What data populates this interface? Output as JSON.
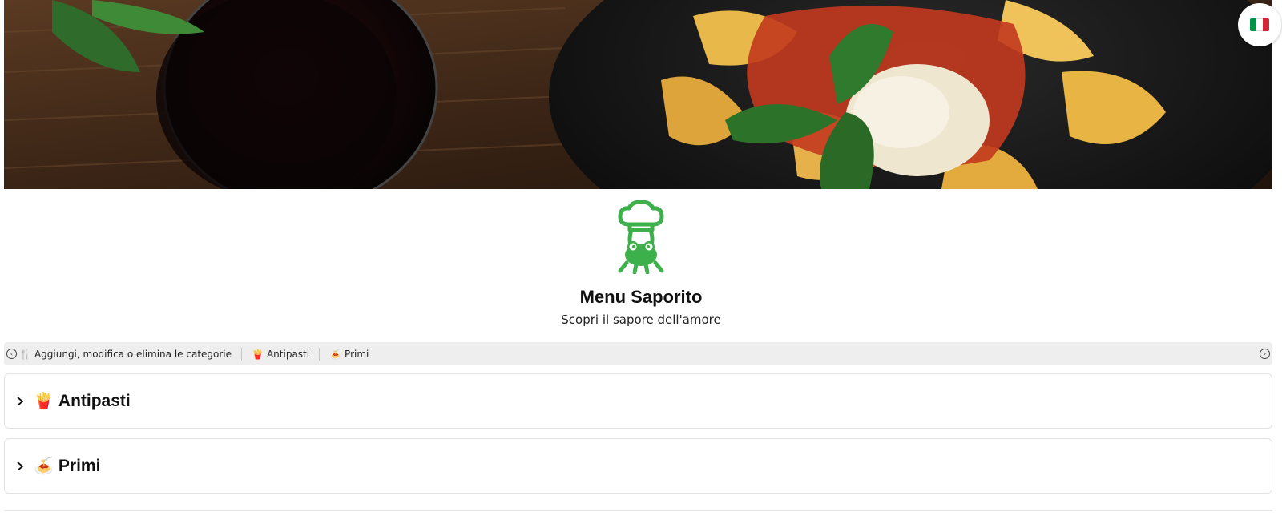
{
  "hero": {
    "image": "pasta-and-red-wine-photo"
  },
  "language": {
    "flag_colors": [
      "#009246",
      "#ffffff",
      "#ce2b37"
    ],
    "icon": "italian-flag-icon"
  },
  "brand": {
    "logo_icon": "chef-mascot-icon",
    "logo_color": "#3db04b",
    "title": "Menu Saporito",
    "subtitle": "Scopri il sapore dell'amore"
  },
  "category_bar": {
    "manage_label": "Aggiungi, modifica o elimina le categorie",
    "manage_icon": "cutlery-icon",
    "items": [
      {
        "emoji": "🍟",
        "label": "Antipasti"
      },
      {
        "emoji": "🍝",
        "label": "Primi"
      }
    ]
  },
  "sections": [
    {
      "emoji": "🍟",
      "title": "Antipasti"
    },
    {
      "emoji": "🍝",
      "title": "Primi"
    }
  ]
}
